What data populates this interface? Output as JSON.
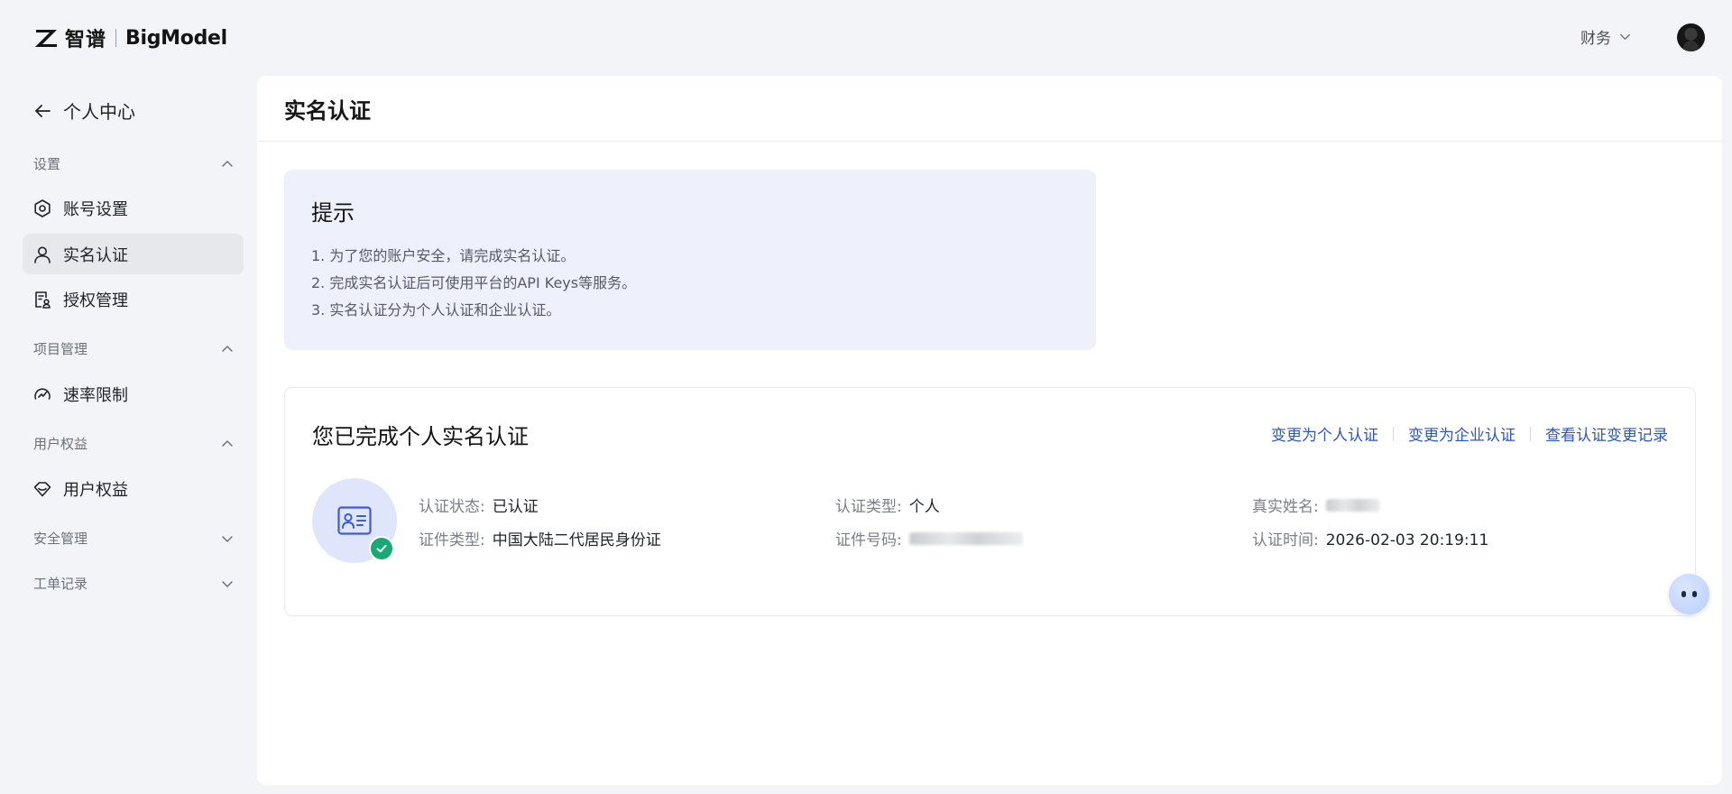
{
  "header": {
    "brand_cn": "智谱",
    "brand_en": "BigModel",
    "menu_label": "财务"
  },
  "sidebar": {
    "back_label": "个人中心",
    "groups": [
      {
        "title": "设置",
        "expanded": true,
        "items": [
          {
            "label": "账号设置",
            "icon": "settings-icon"
          },
          {
            "label": "实名认证",
            "icon": "user-icon",
            "active": true
          },
          {
            "label": "授权管理",
            "icon": "authorization-icon"
          }
        ]
      },
      {
        "title": "项目管理",
        "expanded": true,
        "items": [
          {
            "label": "速率限制",
            "icon": "speedometer-icon"
          }
        ]
      },
      {
        "title": "用户权益",
        "expanded": true,
        "items": [
          {
            "label": "用户权益",
            "icon": "benefits-icon"
          }
        ]
      },
      {
        "title": "安全管理",
        "expanded": false,
        "items": []
      },
      {
        "title": "工单记录",
        "expanded": false,
        "items": []
      }
    ]
  },
  "main": {
    "title": "实名认证",
    "tip": {
      "title": "提示",
      "lines": [
        "1. 为了您的账户安全，请完成实名认证。",
        "2. 完成实名认证后可使用平台的API Keys等服务。",
        "3. 实名认证分为个人认证和企业认证。"
      ]
    },
    "cert": {
      "title": "您已完成个人实名认证",
      "actions": [
        "变更为个人认证",
        "变更为企业认证",
        "查看认证变更记录"
      ],
      "fields": {
        "status_label": "认证状态",
        "status_value": "已认证",
        "type_label": "认证类型",
        "type_value": "个人",
        "name_label": "真实姓名",
        "doc_type_label": "证件类型",
        "doc_type_value": "中国大陆二代居民身份证",
        "doc_no_label": "证件号码",
        "time_label": "认证时间",
        "time_value": "2026-02-03 20:19:11"
      }
    }
  },
  "colors": {
    "accent_link": "#2a56c6",
    "success": "#19a974",
    "tip_bg": "#eef0fb"
  }
}
